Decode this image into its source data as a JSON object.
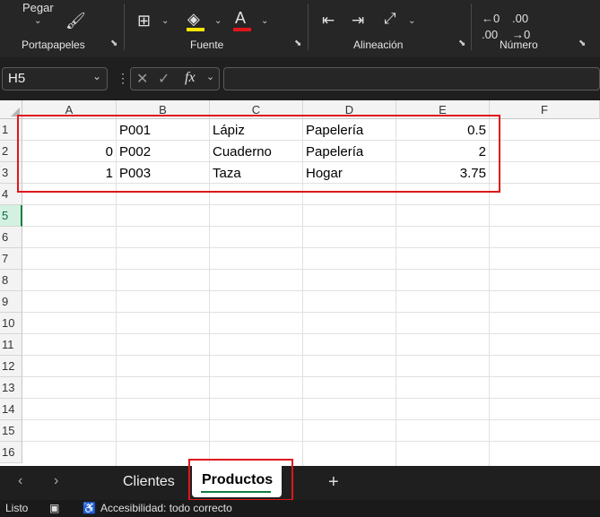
{
  "ribbon": {
    "paste_label": "Pegar",
    "groups": {
      "clipboard": "Portapapeles",
      "font": "Fuente",
      "alignment": "Alineación",
      "number": "Número"
    },
    "colors": {
      "highlight": "#ffe600",
      "font_color": "#e0161c"
    }
  },
  "formula_bar": {
    "name_box": "H5",
    "fx_label": "fx",
    "formula": ""
  },
  "columns": [
    "A",
    "B",
    "C",
    "D",
    "E",
    "F"
  ],
  "rows": [
    "1",
    "2",
    "3",
    "4",
    "5",
    "6",
    "7",
    "8",
    "9",
    "10",
    "11",
    "12",
    "13",
    "14",
    "15",
    "16"
  ],
  "selected_row": "5",
  "cells": [
    [
      "",
      "P001",
      "Lápiz",
      "Papelería",
      "0.5"
    ],
    [
      "0",
      "P002",
      "Cuaderno",
      "Papelería",
      "2"
    ],
    [
      "1",
      "P003",
      "Taza",
      "Hogar",
      "3.75"
    ]
  ],
  "sheets": {
    "tabs": [
      "Clientes",
      "Productos"
    ],
    "active": "Productos",
    "add_label": "+"
  },
  "status": {
    "ready": "Listo",
    "accessibility": "Accesibilidad: todo correcto"
  },
  "accent": "#107c41",
  "highlight_box_color": "#e0161c"
}
